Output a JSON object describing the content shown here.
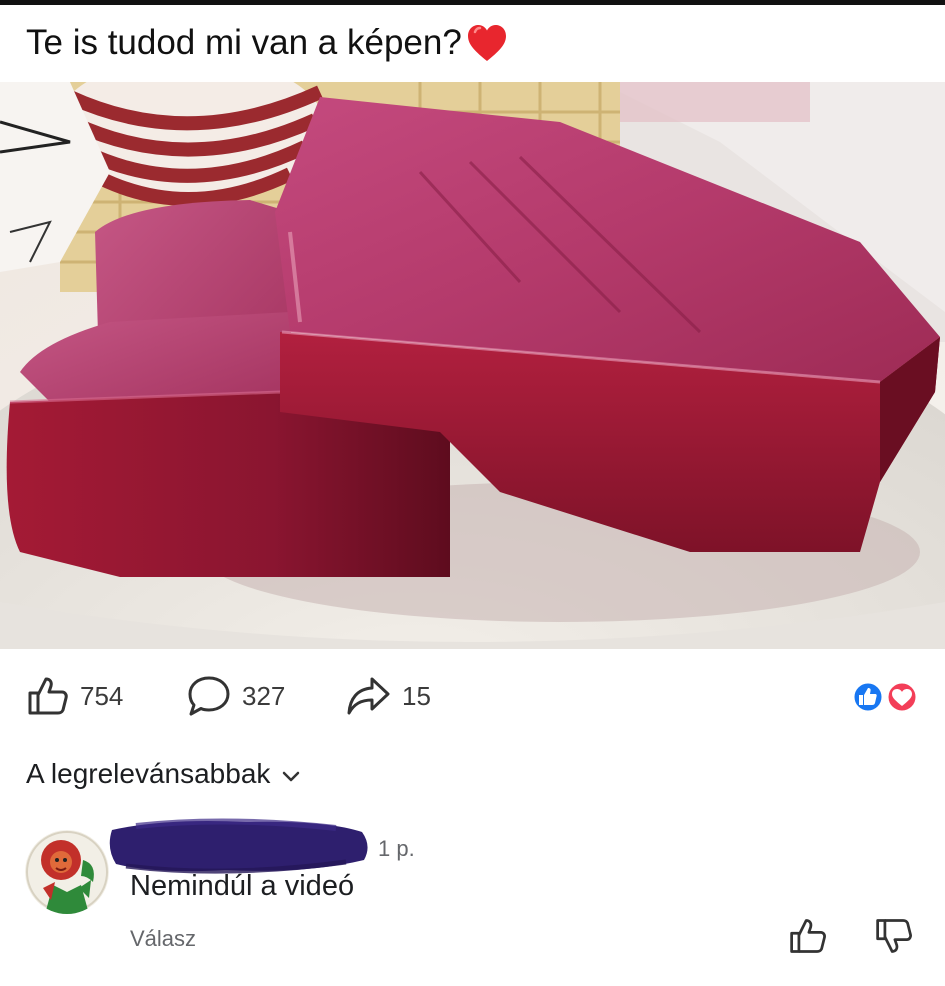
{
  "post": {
    "title": "Te is tudod mi van a képen?",
    "title_emoji": "red-heart-icon"
  },
  "stats": {
    "likes": "754",
    "comments": "327",
    "shares": "15",
    "reaction_icons": [
      "like-reaction-icon",
      "love-reaction-icon"
    ]
  },
  "sort": {
    "label": "A legrelevánsabbak",
    "icon": "chevron-down-icon"
  },
  "comment": {
    "time": "1 p.",
    "text": "Nemindúl a videó",
    "reply_label": "Válasz",
    "avatar": "lion-avatar",
    "vote_icons": [
      "thumbs-up-icon",
      "thumbs-down-icon"
    ]
  },
  "colors": {
    "accent_blue": "#1877f2",
    "love_red": "#f33e58",
    "jelly_red": "#9e1a38",
    "redaction": "#2e1f6e"
  }
}
